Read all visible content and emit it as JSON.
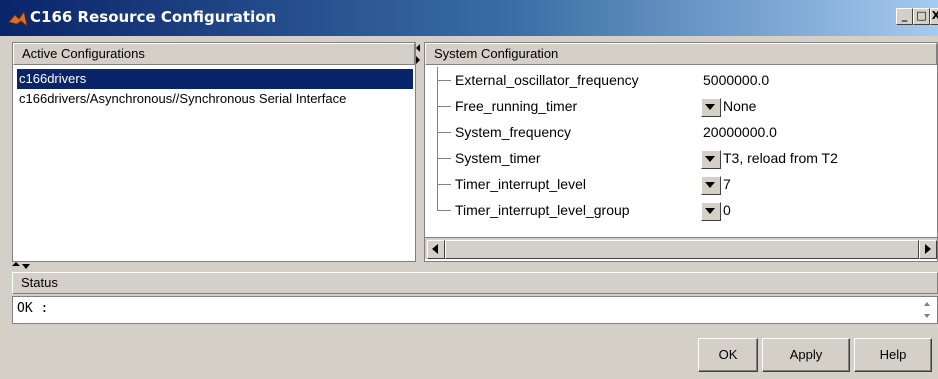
{
  "window": {
    "title": "C166 Resource Configuration",
    "icon": "matlab-icon",
    "controls": {
      "minimize": "_",
      "maximize": "□",
      "close": "X"
    }
  },
  "active_configurations": {
    "header": "Active Configurations",
    "items": [
      {
        "label": "c166drivers",
        "selected": true
      },
      {
        "label": "c166drivers/Asynchronous//Synchronous Serial Interface",
        "selected": false
      }
    ]
  },
  "system_configuration": {
    "header": "System Configuration",
    "properties": [
      {
        "name": "External_oscillator_frequency",
        "value": "5000000.0",
        "dropdown": false
      },
      {
        "name": "Free_running_timer",
        "value": "None",
        "dropdown": true
      },
      {
        "name": "System_frequency",
        "value": "20000000.0",
        "dropdown": false
      },
      {
        "name": "System_timer",
        "value": "T3, reload from T2",
        "dropdown": true
      },
      {
        "name": "Timer_interrupt_level",
        "value": "7",
        "dropdown": true
      },
      {
        "name": "Timer_interrupt_level_group",
        "value": "0",
        "dropdown": true
      }
    ]
  },
  "status": {
    "header": "Status",
    "text": "OK :"
  },
  "buttons": {
    "ok": "OK",
    "apply": "Apply",
    "help": "Help"
  },
  "colors": {
    "titlebar_start": "#0a246a",
    "titlebar_end": "#a6caf0",
    "selection": "#0a246a",
    "face": "#d4d0c8"
  }
}
